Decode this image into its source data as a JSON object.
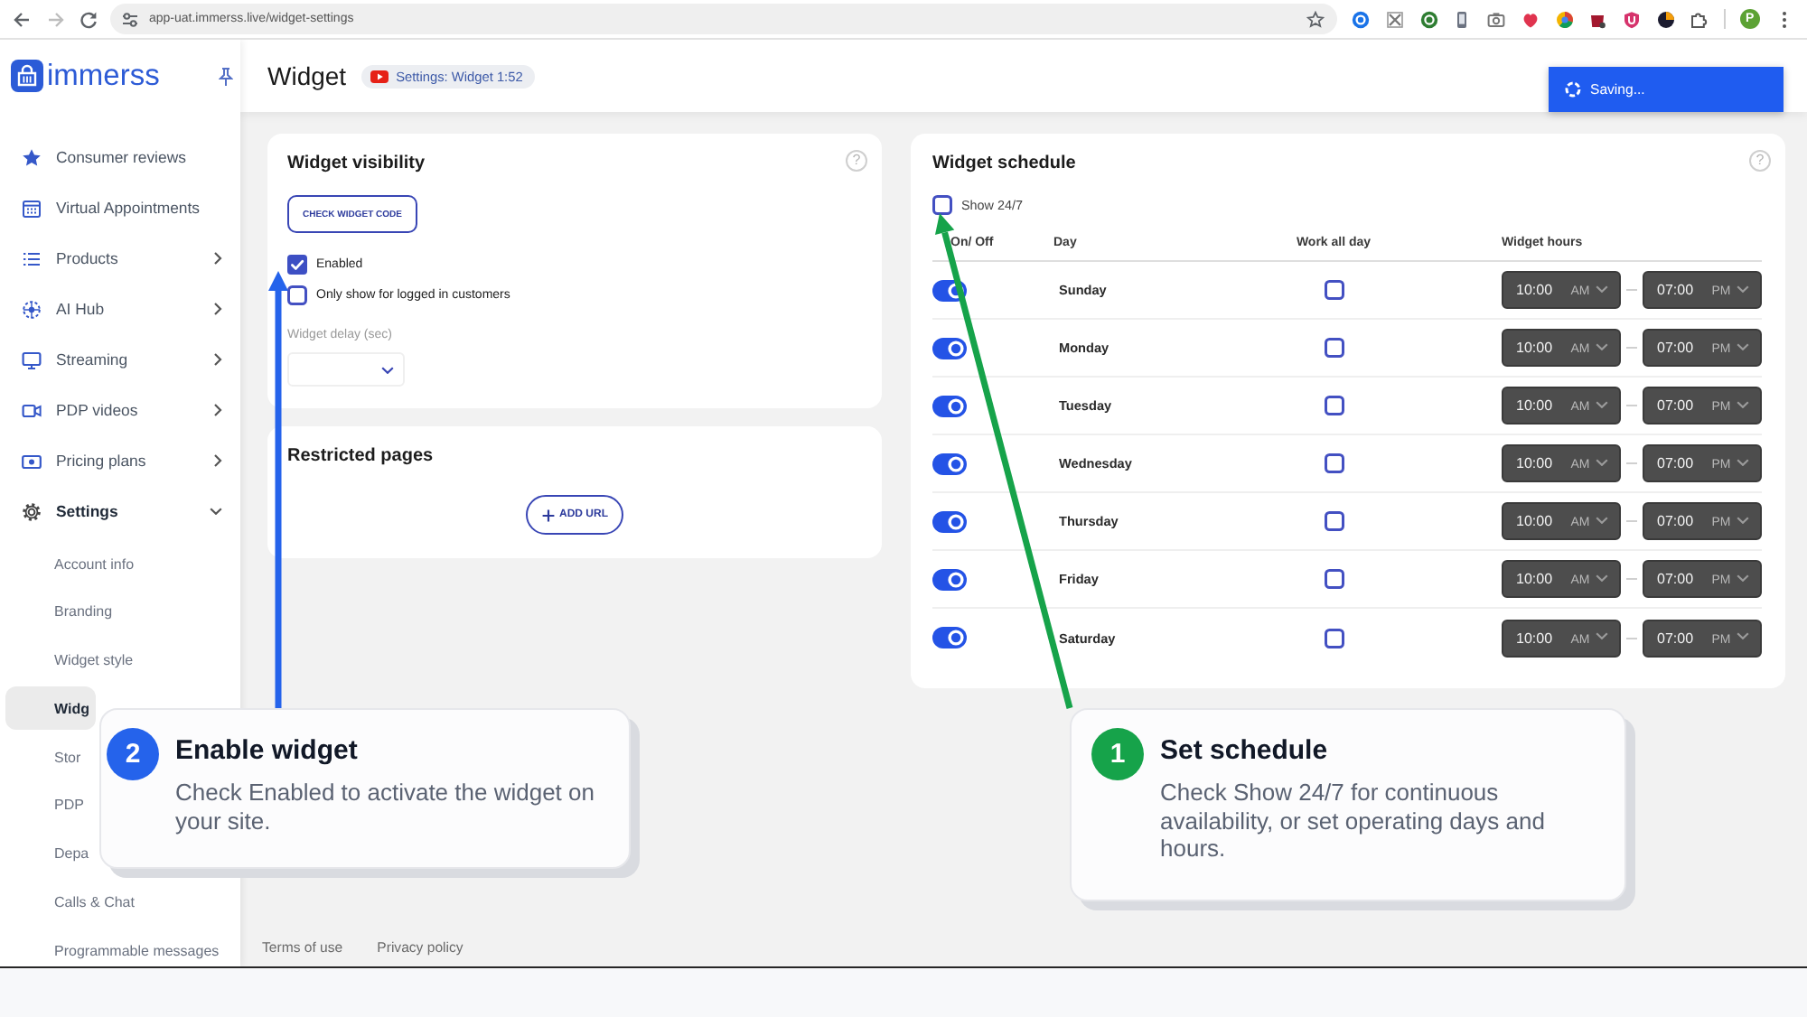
{
  "browser": {
    "url": "app-uat.immerss.live/widget-settings",
    "profile_initial": "P"
  },
  "sidebar": {
    "logo_text": "immerss",
    "items": [
      {
        "kind": "link",
        "label": "Consumer reviews"
      },
      {
        "kind": "link",
        "label": "Virtual Appointments"
      },
      {
        "kind": "group",
        "label": "Products",
        "expanded": false
      },
      {
        "kind": "group",
        "label": "AI Hub",
        "expanded": false
      },
      {
        "kind": "group",
        "label": "Streaming",
        "expanded": false
      },
      {
        "kind": "group",
        "label": "PDP videos",
        "expanded": false
      },
      {
        "kind": "group",
        "label": "Pricing plans",
        "expanded": false
      },
      {
        "kind": "group",
        "label": "Settings",
        "expanded": true,
        "children": [
          {
            "label": "Account info",
            "selected": false
          },
          {
            "label": "Branding",
            "selected": false
          },
          {
            "label": "Widget style",
            "selected": false
          },
          {
            "label": "Widg",
            "selected": true
          },
          {
            "label": "Stor",
            "selected": false
          },
          {
            "label": "PDP",
            "selected": false
          },
          {
            "label": "Depa",
            "selected": false
          },
          {
            "label": "Calls & Chat",
            "selected": false
          },
          {
            "label": "Programmable messages",
            "selected": false
          }
        ]
      }
    ]
  },
  "header": {
    "title": "Widget",
    "video_chip": "Settings: Widget 1:52"
  },
  "toast": {
    "text": "Saving..."
  },
  "visibility": {
    "title": "Widget visibility",
    "help": "?",
    "button": "CHECK WIDGET CODE",
    "options": [
      {
        "label": "Enabled",
        "checked": true
      },
      {
        "label": "Only show for logged in customers",
        "checked": false
      }
    ],
    "delay_label": "Widget delay (sec)"
  },
  "restricted": {
    "title": "Restricted pages",
    "button": "ADD URL"
  },
  "schedule": {
    "title": "Widget schedule",
    "help": "?",
    "show_all": {
      "label": "Show 24/7",
      "checked": false
    },
    "columns": [
      "On/ Off",
      "Day",
      "Work all day",
      "Widget hours"
    ],
    "rows": [
      {
        "on": true,
        "day": "Sunday",
        "work_all_day": false,
        "start": "10:00",
        "start_period": "AM",
        "end": "07:00",
        "end_period": "PM"
      },
      {
        "on": true,
        "day": "Monday",
        "work_all_day": false,
        "start": "10:00",
        "start_period": "AM",
        "end": "07:00",
        "end_period": "PM"
      },
      {
        "on": true,
        "day": "Tuesday",
        "work_all_day": false,
        "start": "10:00",
        "start_period": "AM",
        "end": "07:00",
        "end_period": "PM"
      },
      {
        "on": true,
        "day": "Wednesday",
        "work_all_day": false,
        "start": "10:00",
        "start_period": "AM",
        "end": "07:00",
        "end_period": "PM"
      },
      {
        "on": true,
        "day": "Thursday",
        "work_all_day": false,
        "start": "10:00",
        "start_period": "AM",
        "end": "07:00",
        "end_period": "PM"
      },
      {
        "on": true,
        "day": "Friday",
        "work_all_day": false,
        "start": "10:00",
        "start_period": "AM",
        "end": "07:00",
        "end_period": "PM"
      },
      {
        "on": true,
        "day": "Saturday",
        "work_all_day": false,
        "start": "10:00",
        "start_period": "AM",
        "end": "07:00",
        "end_period": "PM"
      }
    ]
  },
  "callouts": [
    {
      "number": "2",
      "title": "Enable widget",
      "text": "Check Enabled to activate the widget on your site.",
      "color": "#2563eb"
    },
    {
      "number": "1",
      "title": "Set schedule",
      "text": "Check Show 24/7 for continuous availability, or set operating days and hours.",
      "color": "#16a34a"
    }
  ],
  "footer": {
    "links": [
      "Terms of use",
      "Privacy policy"
    ]
  }
}
